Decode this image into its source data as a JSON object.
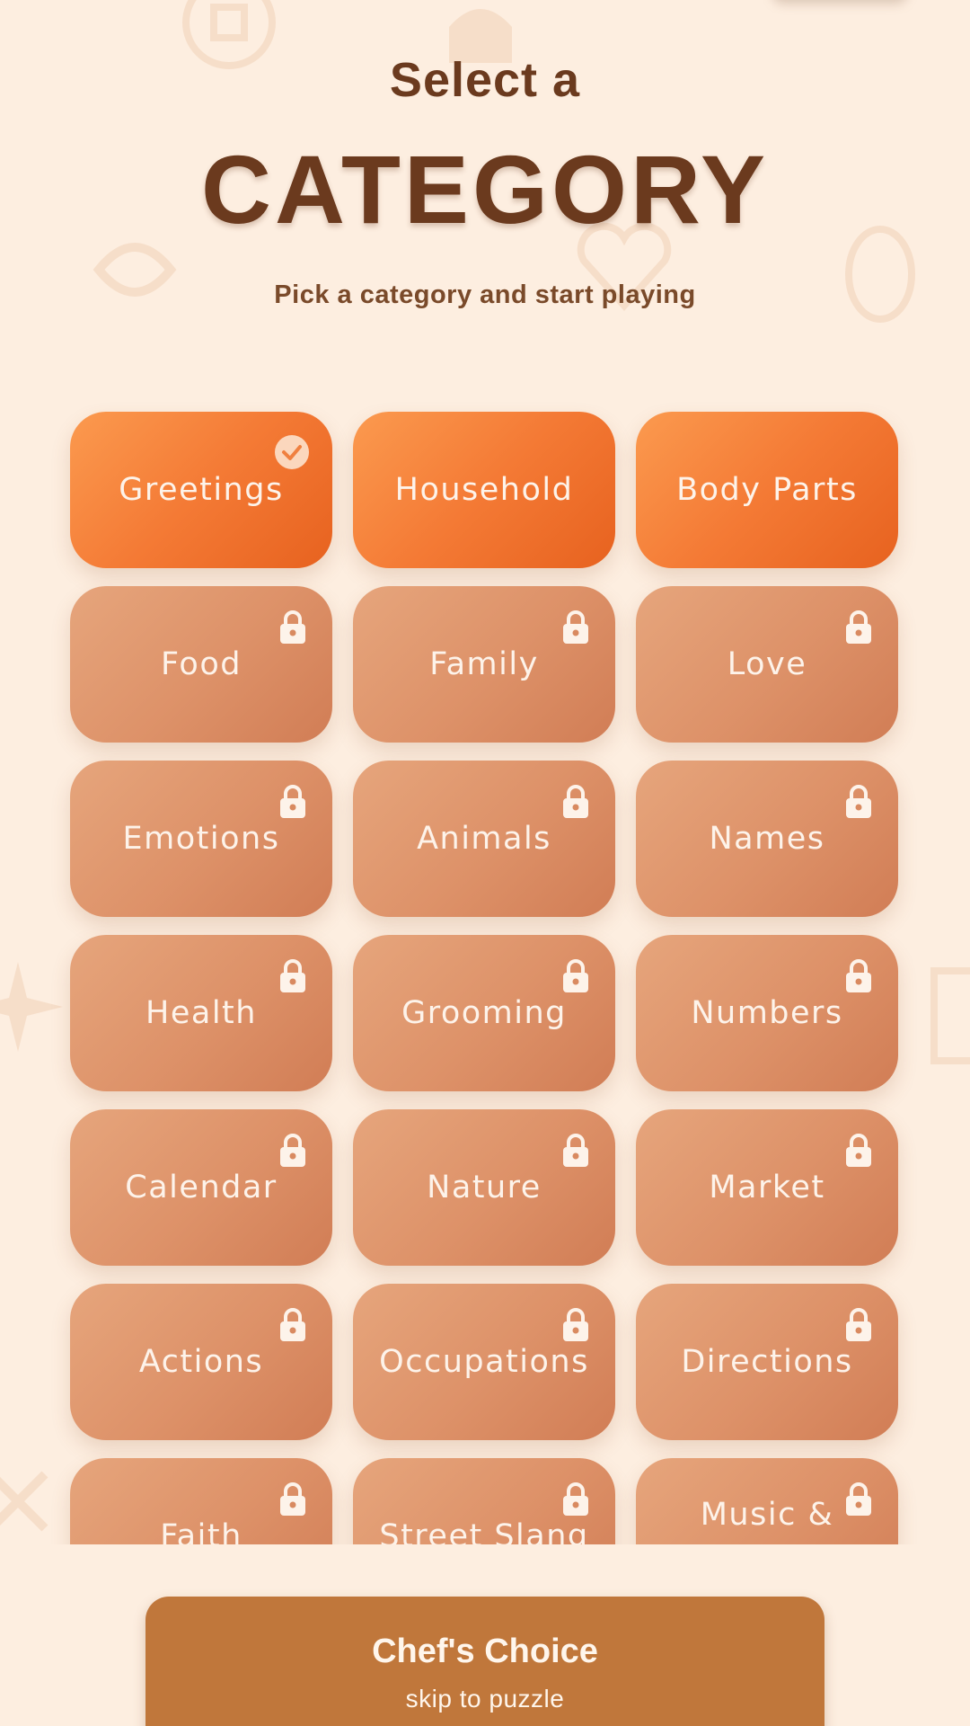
{
  "header": {
    "pre_title": "Select a",
    "title": "CATEGORY",
    "subtitle": "Pick a category and start playing"
  },
  "categories": [
    {
      "label": "Greetings",
      "state": "selected",
      "icon": "check-icon"
    },
    {
      "label": "Household",
      "state": "unlocked"
    },
    {
      "label": "Body Parts",
      "state": "unlocked"
    },
    {
      "label": "Food",
      "state": "locked",
      "icon": "lock-icon"
    },
    {
      "label": "Family",
      "state": "locked",
      "icon": "lock-icon"
    },
    {
      "label": "Love",
      "state": "locked",
      "icon": "lock-icon"
    },
    {
      "label": "Emotions",
      "state": "locked",
      "icon": "lock-icon"
    },
    {
      "label": "Animals",
      "state": "locked",
      "icon": "lock-icon"
    },
    {
      "label": "Names",
      "state": "locked",
      "icon": "lock-icon"
    },
    {
      "label": "Health",
      "state": "locked",
      "icon": "lock-icon"
    },
    {
      "label": "Grooming",
      "state": "locked",
      "icon": "lock-icon"
    },
    {
      "label": "Numbers",
      "state": "locked",
      "icon": "lock-icon"
    },
    {
      "label": "Calendar",
      "state": "locked",
      "icon": "lock-icon"
    },
    {
      "label": "Nature",
      "state": "locked",
      "icon": "lock-icon"
    },
    {
      "label": "Market",
      "state": "locked",
      "icon": "lock-icon"
    },
    {
      "label": "Actions",
      "state": "locked",
      "icon": "lock-icon"
    },
    {
      "label": "Occupations",
      "state": "locked",
      "icon": "lock-icon"
    },
    {
      "label": "Directions",
      "state": "locked",
      "icon": "lock-icon"
    },
    {
      "label": "Faith",
      "state": "locked",
      "icon": "lock-icon"
    },
    {
      "label": "Street Slang",
      "state": "locked",
      "icon": "lock-icon"
    },
    {
      "label": "Music &",
      "state": "locked",
      "icon": "lock-icon"
    }
  ],
  "chef_button": {
    "title": "Chef's Choice",
    "subtitle": "skip to puzzle"
  },
  "colors": {
    "background": "#fdeee0",
    "title_text": "#6b3a1e",
    "tile_unlocked": "#f47a35",
    "tile_locked": "#dd9168",
    "chef_button": "#c0773b"
  }
}
